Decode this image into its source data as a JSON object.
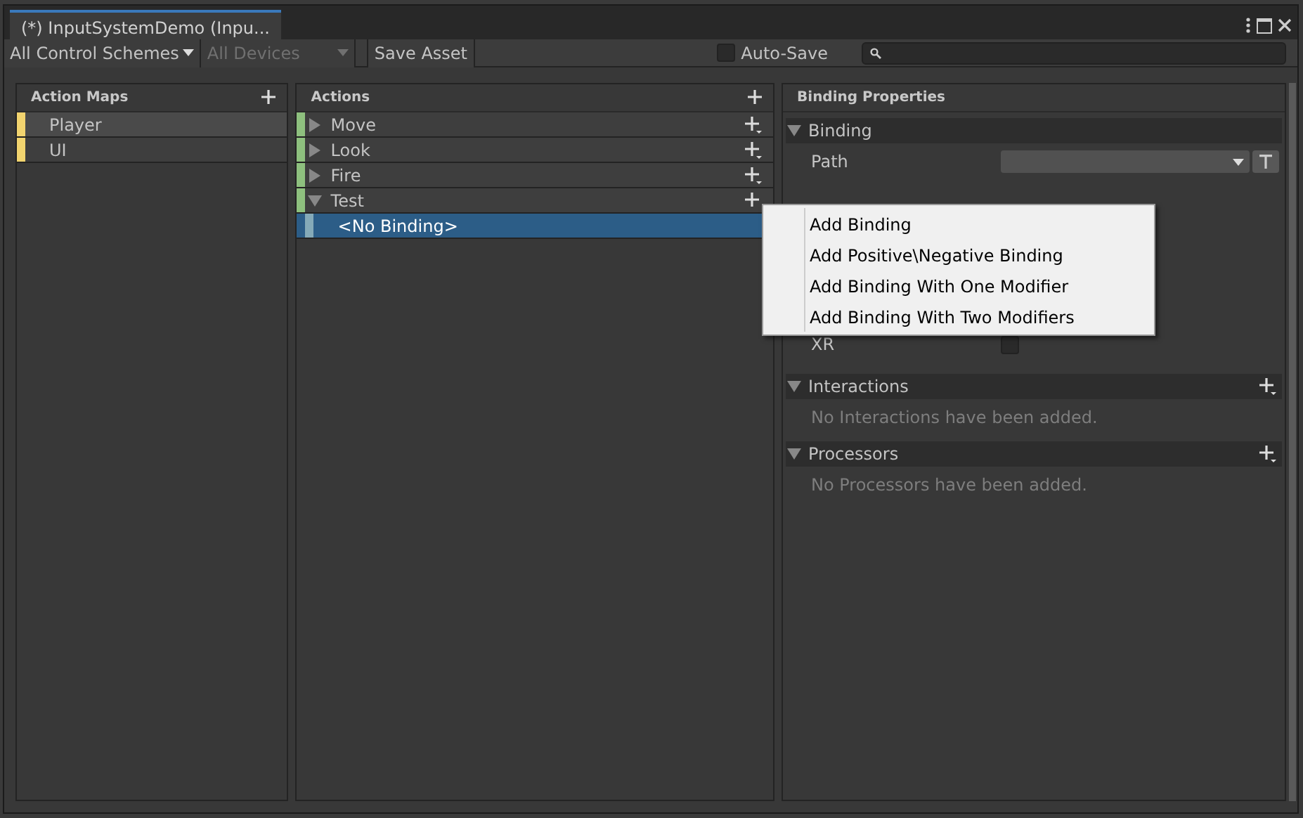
{
  "window": {
    "title": "(*) InputSystemDemo (Inpu..."
  },
  "toolbar": {
    "control_schemes": "All Control Schemes",
    "devices": {
      "label": "All Devices",
      "disabled": true
    },
    "save_button": "Save Asset",
    "auto_save": {
      "label": "Auto-Save",
      "checked": false
    }
  },
  "action_maps": {
    "title": "Action Maps",
    "items": [
      {
        "label": "Player",
        "selected": true
      },
      {
        "label": "UI",
        "selected": false
      }
    ]
  },
  "actions": {
    "title": "Actions",
    "items": [
      {
        "label": "Move",
        "expanded": false
      },
      {
        "label": "Look",
        "expanded": false
      },
      {
        "label": "Fire",
        "expanded": false
      },
      {
        "label": "Test",
        "expanded": true,
        "children": [
          {
            "label": "<No Binding>",
            "selected": true
          }
        ]
      }
    ]
  },
  "binding_properties": {
    "title": "Binding Properties",
    "sections": [
      {
        "kind": "binding",
        "title": "Binding",
        "expanded": true,
        "path_label": "Path",
        "xr_label": "XR",
        "xr_checked": false
      },
      {
        "kind": "list",
        "title": "Interactions",
        "expanded": true,
        "empty_text": "No Interactions have been added."
      },
      {
        "kind": "list",
        "title": "Processors",
        "expanded": true,
        "empty_text": "No Processors have been added."
      }
    ]
  },
  "context_menu": {
    "items": [
      "Add Binding",
      "Add Positive\\Negative Binding",
      "Add Binding With One Modifier",
      "Add Binding With Two Modifiers"
    ]
  }
}
